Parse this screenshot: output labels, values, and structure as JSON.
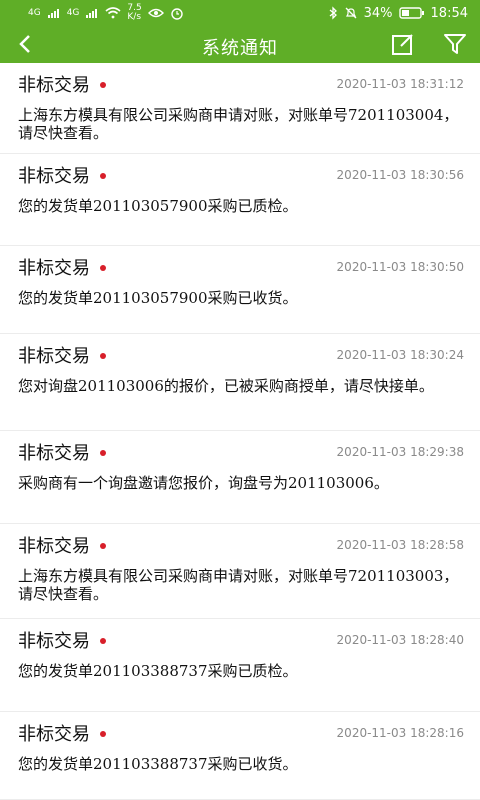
{
  "status_bar": {
    "signal_1": "4G",
    "signal_2": "4G",
    "speed": "7.5",
    "speed_unit": "K/s",
    "battery": "34%",
    "time": "18:54"
  },
  "header": {
    "title": "系统通知"
  },
  "notifications": [
    {
      "sender": "非标交易",
      "time": "2020-11-03 18:31:12",
      "message": "上海东方模具有限公司采购商申请对账，对账单号7201103004，请尽快查看。"
    },
    {
      "sender": "非标交易",
      "time": "2020-11-03 18:30:56",
      "message": "您的发货单201103057900采购已质检。"
    },
    {
      "sender": "非标交易",
      "time": "2020-11-03 18:30:50",
      "message": "您的发货单201103057900采购已收货。"
    },
    {
      "sender": "非标交易",
      "time": "2020-11-03 18:30:24",
      "message": "您对询盘201103006的报价，已被采购商授单，请尽快接单。"
    },
    {
      "sender": "非标交易",
      "time": "2020-11-03 18:29:38",
      "message": "采购商有一个询盘邀请您报价，询盘号为201103006。"
    },
    {
      "sender": "非标交易",
      "time": "2020-11-03 18:28:58",
      "message": "上海东方模具有限公司采购商申请对账，对账单号7201103003，请尽快查看。"
    },
    {
      "sender": "非标交易",
      "time": "2020-11-03 18:28:40",
      "message": "您的发货单201103388737采购已质检。"
    },
    {
      "sender": "非标交易",
      "time": "2020-11-03 18:28:16",
      "message": "您的发货单201103388737采购已收货。"
    }
  ],
  "colors": {
    "appbar": "#5fae27",
    "unread_dot": "#d81f2a",
    "time_text": "#8a8a8a"
  }
}
